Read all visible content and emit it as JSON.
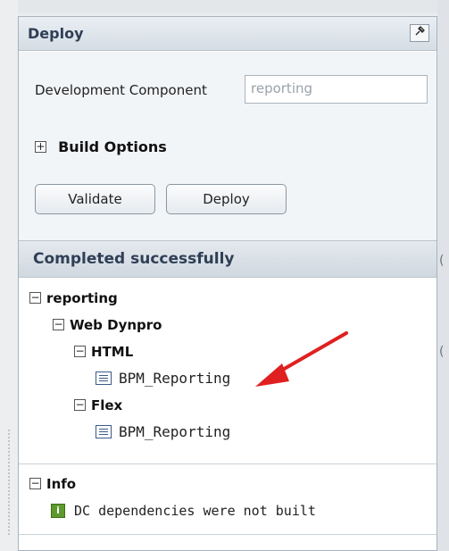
{
  "panel": {
    "title": "Deploy",
    "pin_icon": "pin-icon"
  },
  "form": {
    "dc_label": "Development Component",
    "dc_value": "reporting"
  },
  "build_options": {
    "expander": "+",
    "label": "Build Options"
  },
  "buttons": {
    "validate": "Validate",
    "deploy": "Deploy"
  },
  "status": {
    "text": "Completed successfully"
  },
  "tree": {
    "root": "reporting",
    "web_dynpro": "Web Dynpro",
    "html": "HTML",
    "html_item": "BPM_Reporting",
    "flex": "Flex",
    "flex_item": "BPM_Reporting"
  },
  "info": {
    "heading": "Info",
    "icon": "i",
    "message": "DC dependencies were not built"
  },
  "colors": {
    "accent_arrow": "#e02020",
    "header_text": "#2f3f55",
    "info_green": "#5c9a2d"
  }
}
